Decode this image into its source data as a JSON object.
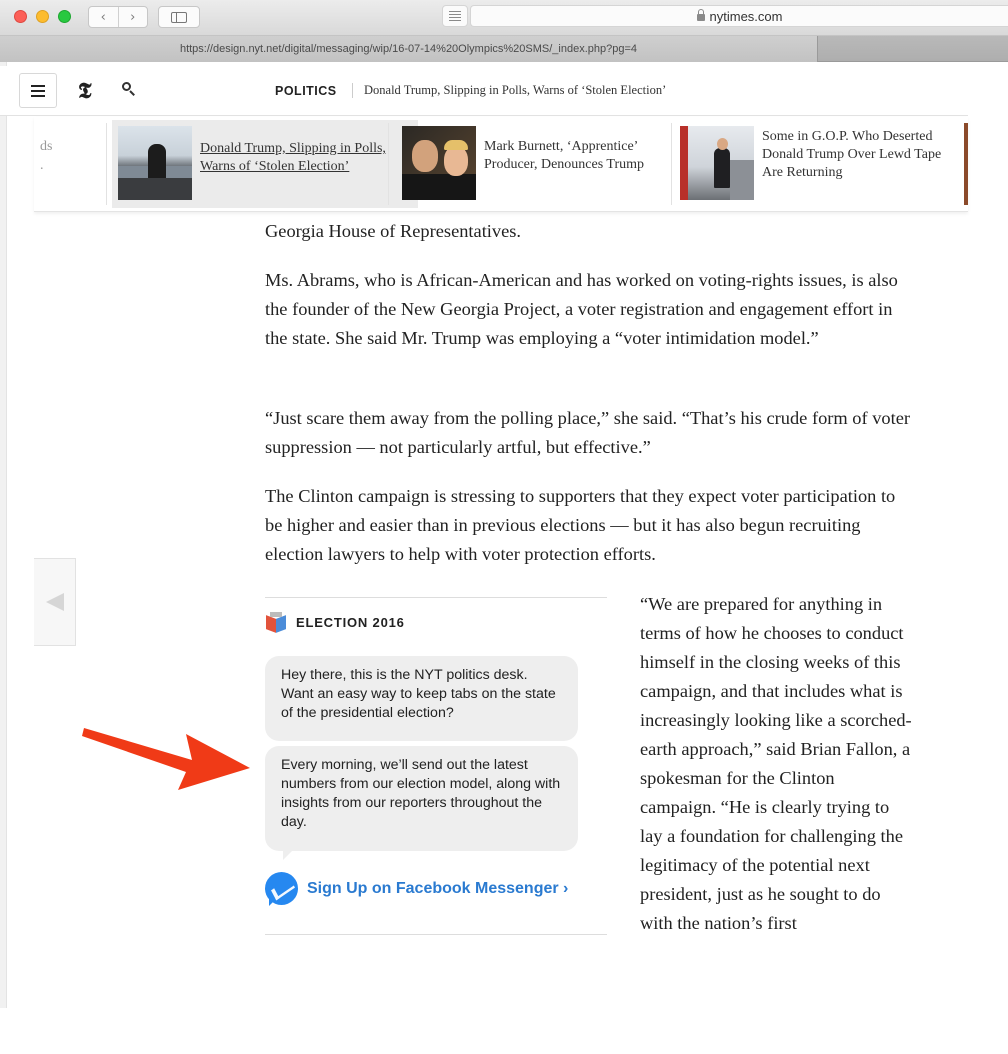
{
  "browser": {
    "address_host": "nytimes.com",
    "tab_url": "https://design.nyt.net/digital/messaging/wip/16-07-14%20Olympics%20SMS/_index.php?pg=4"
  },
  "header": {
    "section": "POLITICS",
    "headline": "Donald Trump, Slipping in Polls, Warns of ‘Stolen Election’",
    "logo": "𝕿"
  },
  "related": {
    "partial_text": "ds\n.",
    "items": [
      {
        "title": "Donald Trump, Slipping in Polls, Warns of ‘Stolen Election’",
        "selected": true
      },
      {
        "title": "Mark Burnett, ‘Apprentice’ Producer, Denounces Trump",
        "selected": false
      },
      {
        "title": "Some in G.O.P. Who Deserted Donald Trump Over Lewd Tape Are Returning",
        "selected": false
      }
    ]
  },
  "article": {
    "paragraphs": [
      "Georgia House of Representatives.",
      "Ms. Abrams, who is African-American and has worked on voting-rights issues, is also the founder of the New Georgia Project, a voter registration and engagement effort in the state. She said Mr. Trump was employing a “voter intimidation model.”",
      "“Just scare them away from the polling place,” she said. “That’s his crude form of voter suppression — not particularly artful, but effective.”",
      "The Clinton campaign is stressing to supporters that they expect voter participation to be higher and easier than in previous elections — but it has also begun recruiting election lawyers to help with voter protection efforts."
    ],
    "quote": "“We are prepared for anything in terms of how he chooses to conduct himself in the closing weeks of this campaign, and that includes what is increasingly looking like a scorched-earth approach,” said Brian Fallon, a spokesman for the Clinton campaign. “He is clearly trying to lay a foundation for challenging the legitimacy of the potential next president, just as he sought to do with the nation’s first"
  },
  "election_module": {
    "title": "ELECTION 2016",
    "bubble_1": "Hey there, this is the NYT politics desk. Want an easy way to keep tabs on the state of the presidential election?",
    "bubble_2": "Every morning, we’ll send out the latest numbers from our election model, along with insights from our reporters throughout the day.",
    "signup_label": "Sign Up on Facebook Messenger ›"
  },
  "colors": {
    "messenger_blue": "#2688f0",
    "link_blue": "#2a7ad0",
    "arrow_red": "#f03a17",
    "bubble_gray": "#eeeeee"
  }
}
